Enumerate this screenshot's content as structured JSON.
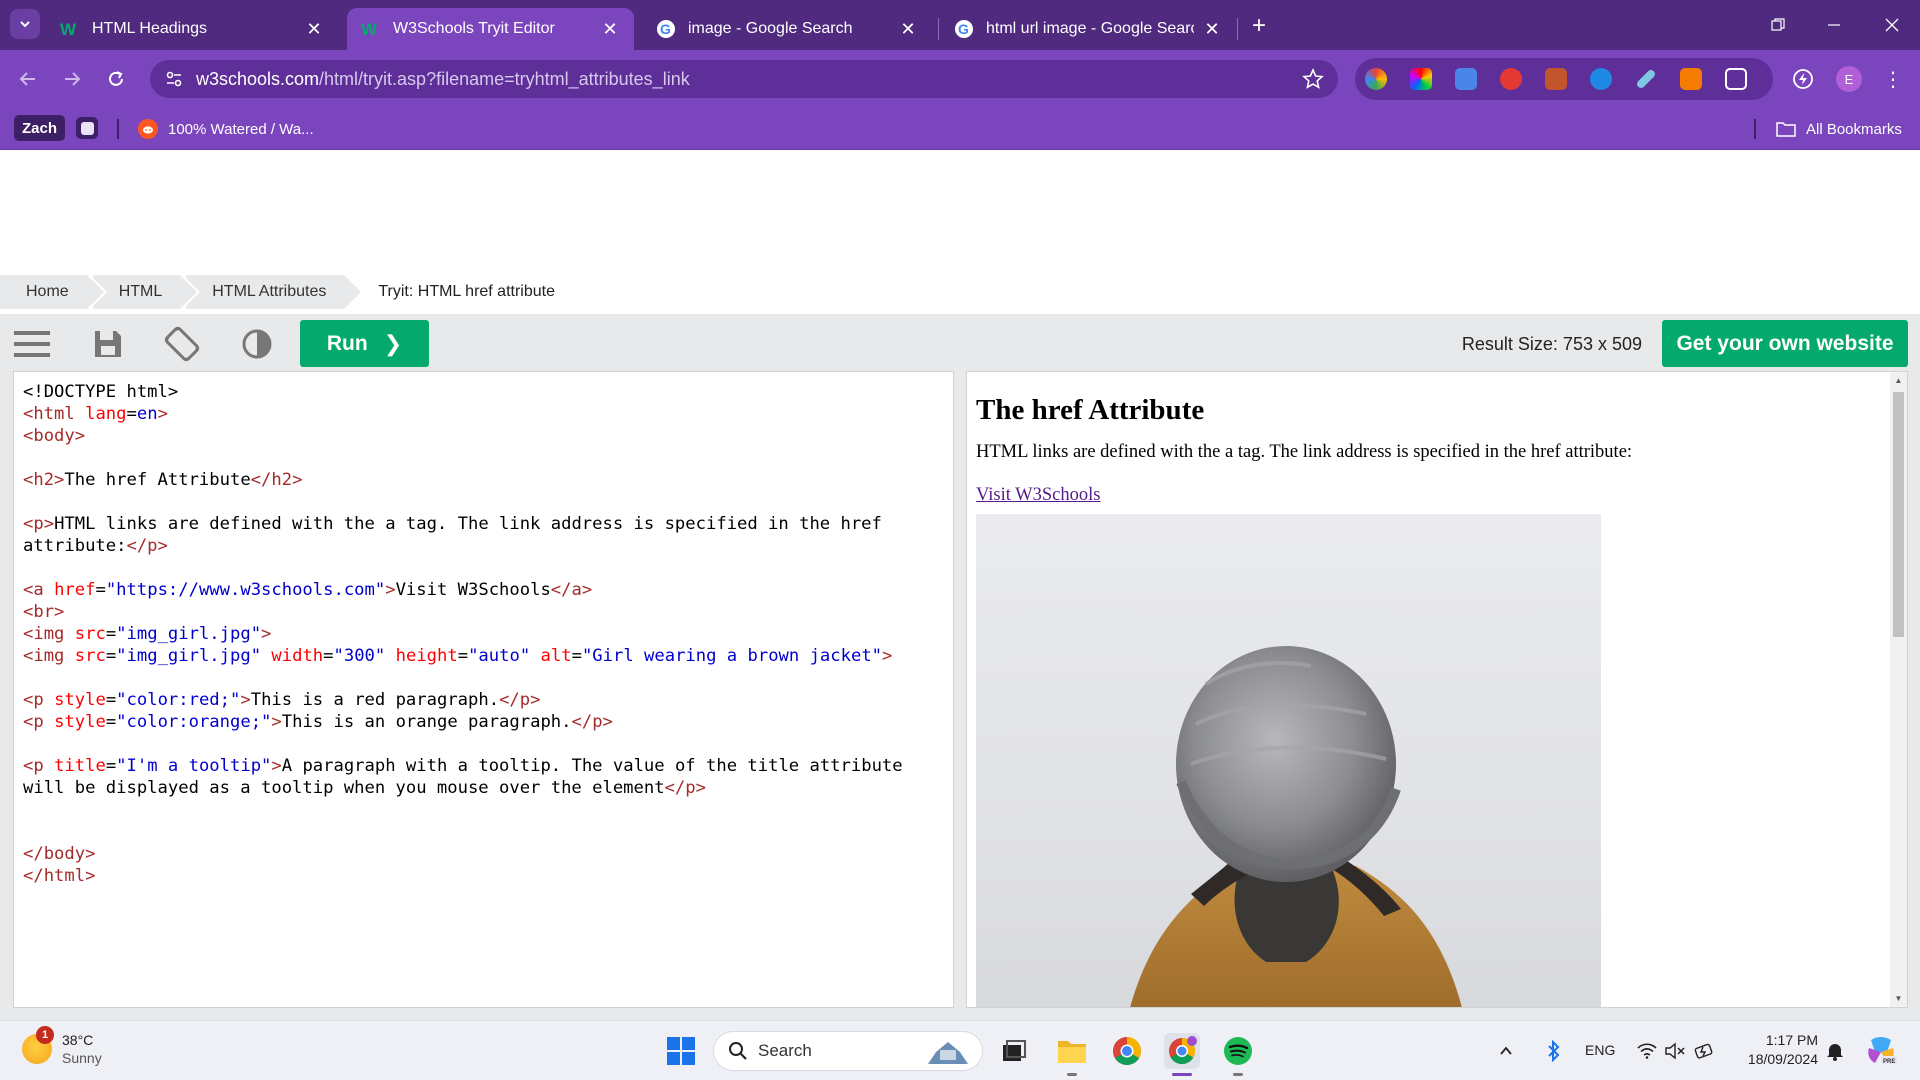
{
  "browser": {
    "tabs": [
      {
        "title": "HTML Headings",
        "favicon": "w3schools-icon",
        "active": false
      },
      {
        "title": "W3Schools Tryit Editor",
        "favicon": "w3schools-icon",
        "active": true
      },
      {
        "title": "image - Google Search",
        "favicon": "google-icon",
        "active": false
      },
      {
        "title": "html url image - Google Search",
        "favicon": "google-icon",
        "active": false
      }
    ],
    "url_host": "w3schools.com",
    "url_path": "/html/tryit.asp?filename=tryhtml_attributes_link",
    "profile_initial": "E",
    "bookmarks": {
      "chip": "Zach",
      "item": "100% Watered / Wa...",
      "all": "All Bookmarks"
    },
    "accent": "#7b45bd"
  },
  "breadcrumb": [
    "Home",
    "HTML",
    "HTML Attributes",
    "Tryit: HTML href attribute"
  ],
  "tryit": {
    "run_label": "Run",
    "run_chevron": "❯",
    "result_size": "Result Size: 753 x 509",
    "get_website_label": "Get your own website",
    "green": "#04aa6d"
  },
  "code_lines": [
    "<!DOCTYPE html>",
    "<html lang=en>",
    "<body>",
    "",
    "<h2>The href Attribute</h2>",
    "",
    "<p>HTML links are defined with the a tag. The link address is specified in the href",
    "attribute:</p>",
    "",
    "<a href=\"https://www.w3schools.com\">Visit W3Schools</a>",
    "<br>",
    "<img src=\"img_girl.jpg\">",
    "<img src=\"img_girl.jpg\" width=\"300\" height=\"auto\" alt=\"Girl wearing a brown jacket\">",
    "",
    "<p style=\"color:red;\">This is a red paragraph.</p>",
    "<p style=\"color:orange;\">This is an orange paragraph.</p>",
    "",
    "<p title=\"I'm a tooltip\">A paragraph with a tooltip. The value of the title attribute",
    "will be displayed as a tooltip when you mouse over the element</p>",
    "",
    "",
    "</body>",
    "</html>"
  ],
  "result": {
    "heading": "The href Attribute",
    "paragraph": "HTML links are defined with the a tag. The link address is specified in the href attribute:",
    "link": "Visit W3Schools"
  },
  "taskbar": {
    "weather_temp": "38°C",
    "weather_cond": "Sunny",
    "weather_badge": "1",
    "search_label": "Search",
    "lang": "ENG",
    "time": "1:17 PM",
    "date": "18/09/2024"
  }
}
